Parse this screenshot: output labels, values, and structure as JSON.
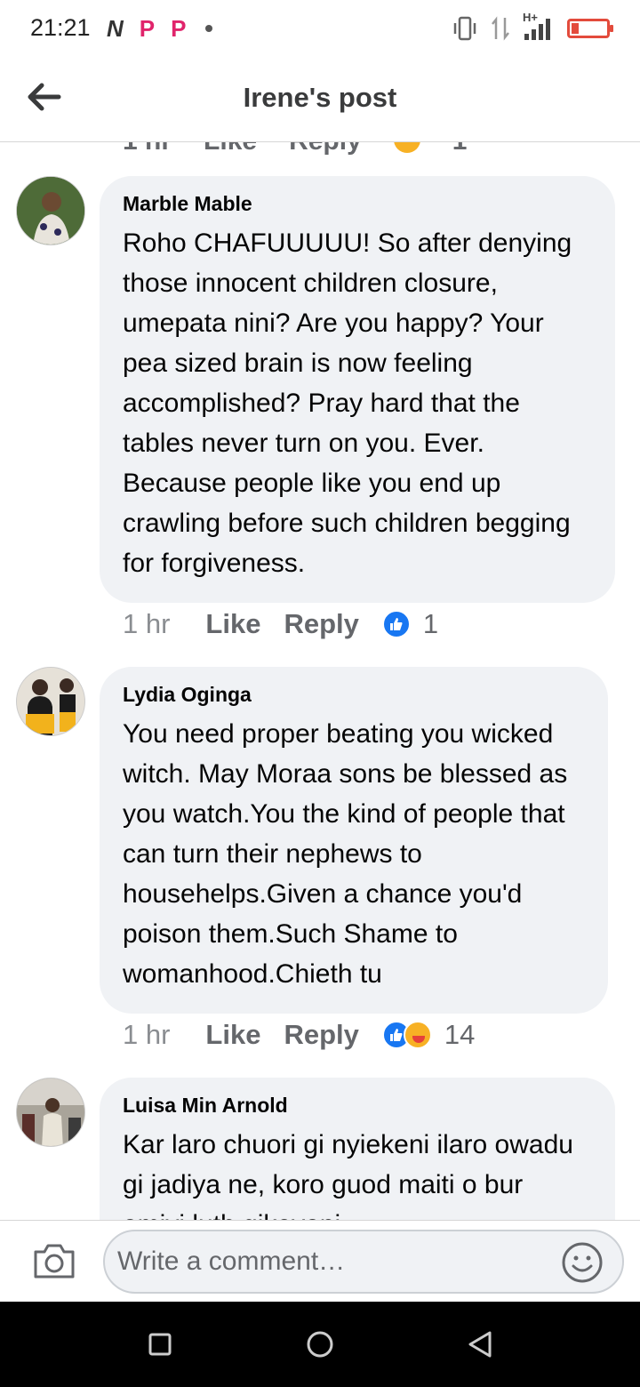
{
  "status_bar": {
    "time": "21:21",
    "icons_left": [
      "netflix-n-icon",
      "p-app-icon",
      "p-app-icon",
      "notification-dot"
    ],
    "icons_right": [
      "vibrate-icon",
      "data-arrows-icon",
      "signal-h-plus-icon",
      "battery-low-icon"
    ],
    "network_label": "H+"
  },
  "header": {
    "title": "Irene's post",
    "back_icon": "arrow-left-icon"
  },
  "previous_comment_meta": {
    "time": "1 hr",
    "like_label": "Like",
    "reply_label": "Reply",
    "reaction_count": "1"
  },
  "comments": [
    {
      "author": "Marble Mable",
      "text": "Roho CHAFUUUUU! So after denying those innocent children closure, umepata nini? Are you happy? Your pea sized brain is now feeling accomplished? Pray hard that the tables never turn on you. Ever. Because people like you end up crawling before such children begging for forgiveness.",
      "time": "1 hr",
      "like_label": "Like",
      "reply_label": "Reply",
      "reactions": [
        "like"
      ],
      "reaction_count": "1"
    },
    {
      "author": "Lydia Oginga",
      "text": "You need proper beating you wicked  witch. May Moraa sons be blessed as you watch.You the kind of people that can turn their nephews to househelps.Given a chance you'd poison them.Such Shame to womanhood.Chieth tu",
      "time": "1 hr",
      "like_label": "Like",
      "reply_label": "Reply",
      "reactions": [
        "like",
        "haha"
      ],
      "reaction_count": "14"
    },
    {
      "author": "Luisa Min Arnold",
      "text": "Kar laro chuori gi nyiekeni ilaro owadu gi jadiya ne, koro guod maiti o bur omiyi luth gikeyoni"
    }
  ],
  "composer": {
    "placeholder": "Write a comment…",
    "camera_icon": "camera-icon",
    "emoji_icon": "smiley-icon"
  },
  "nav_bar": {
    "icons": [
      "recent-apps-square-icon",
      "home-circle-icon",
      "back-triangle-icon"
    ]
  },
  "colors": {
    "bubble": "#f0f2f5",
    "like_blue": "#1877f2",
    "meta_gray": "#65676b",
    "battery_red": "#e34b3c"
  }
}
